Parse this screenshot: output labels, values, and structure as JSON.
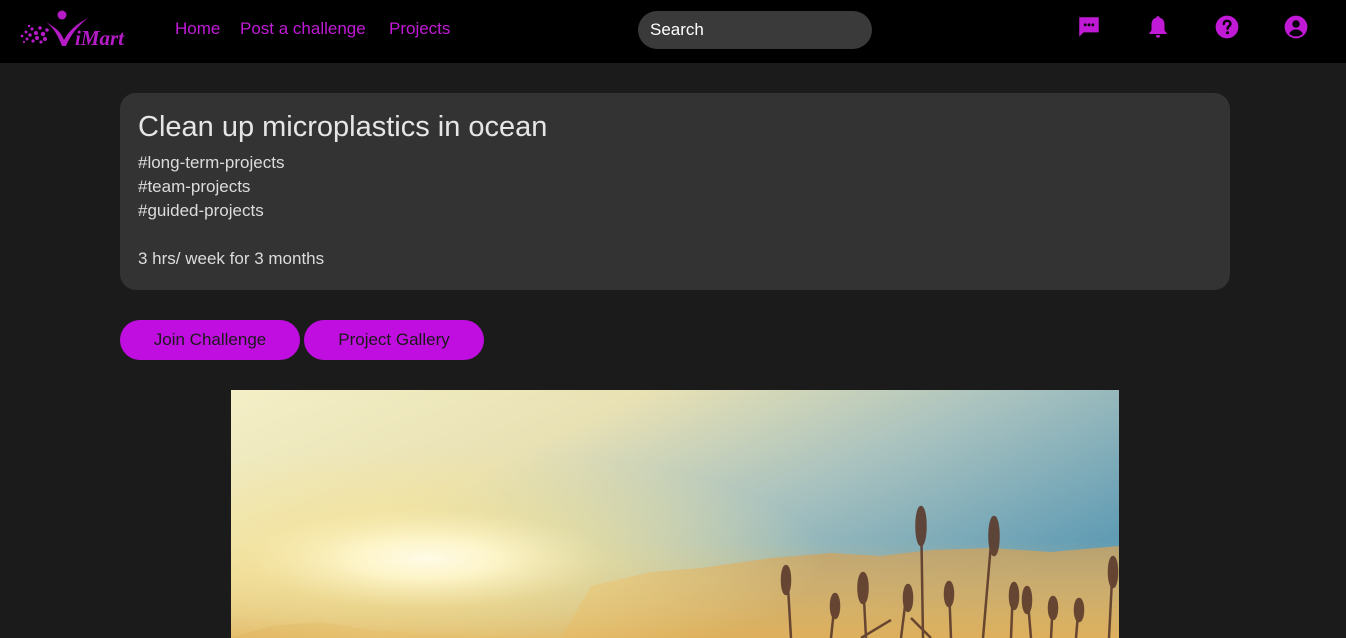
{
  "brand": {
    "name": "iMart",
    "accent": "#c11ad6",
    "button_color": "#c10ee0"
  },
  "nav": {
    "home": "Home",
    "post": "Post a challenge",
    "projects": "Projects"
  },
  "search": {
    "placeholder": "Search"
  },
  "icons": {
    "messages": "chat-icon",
    "notifications": "bell-icon",
    "help": "help-icon",
    "account": "account-icon"
  },
  "challenge": {
    "title": "Clean up microplastics in ocean",
    "tags": [
      "#long-term-projects",
      "#team-projects",
      "#guided-projects"
    ],
    "commitment": "3 hrs/ week for 3 months"
  },
  "actions": {
    "join": "Join Challenge",
    "gallery": "Project Gallery"
  },
  "hero": {
    "subject": "sunset over mountains with tall grass"
  }
}
